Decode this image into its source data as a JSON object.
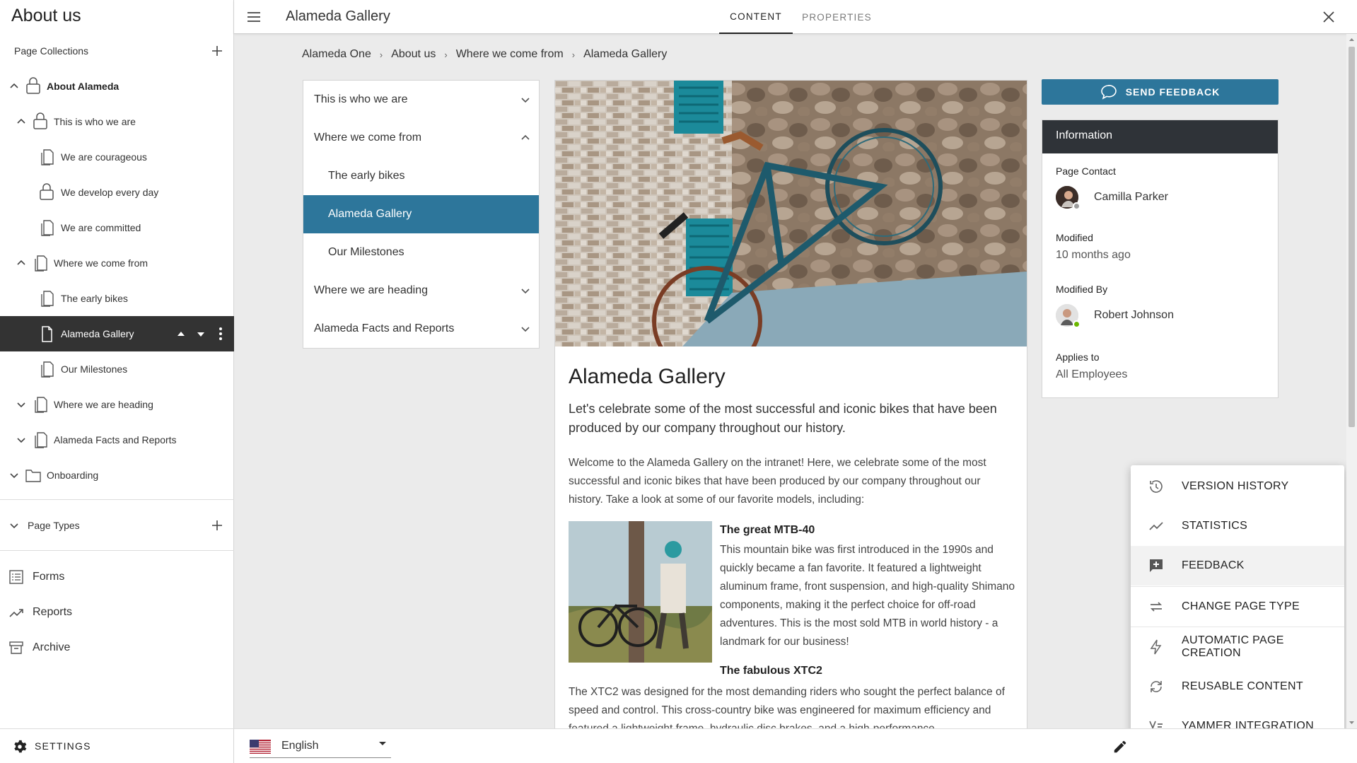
{
  "sidebar": {
    "title": "About us",
    "page_collections_label": "Page Collections",
    "tree": [
      {
        "label": "About Alameda"
      },
      {
        "label": "This is who we are"
      },
      {
        "label": "We are courageous"
      },
      {
        "label": "We develop every day"
      },
      {
        "label": "We are committed"
      },
      {
        "label": "Where we come from"
      },
      {
        "label": "The early bikes"
      },
      {
        "label": "Alameda Gallery"
      },
      {
        "label": "Our Milestones"
      },
      {
        "label": "Where we are heading"
      },
      {
        "label": "Alameda Facts and Reports"
      },
      {
        "label": "Onboarding"
      }
    ],
    "page_types_label": "Page Types",
    "links": [
      {
        "label": "Forms"
      },
      {
        "label": "Reports"
      },
      {
        "label": "Archive"
      }
    ],
    "settings_label": "SETTINGS"
  },
  "topbar": {
    "title": "Alameda Gallery",
    "tabs": [
      {
        "label": "CONTENT"
      },
      {
        "label": "PROPERTIES"
      }
    ]
  },
  "breadcrumb": [
    "Alameda One",
    "About us",
    "Where we come from",
    "Alameda Gallery"
  ],
  "page_nav": [
    {
      "label": "This is who we are"
    },
    {
      "label": "Where we come from"
    },
    {
      "label": "The early bikes"
    },
    {
      "label": "Alameda Gallery"
    },
    {
      "label": "Our Milestones"
    },
    {
      "label": "Where we are heading"
    },
    {
      "label": "Alameda Facts and Reports"
    }
  ],
  "content": {
    "title": "Alameda Gallery",
    "lead": "Let's celebrate some of the most successful and iconic bikes that have been produced by our company throughout our history.",
    "intro": "Welcome to the Alameda Gallery on the intranet! Here, we celebrate some of the most successful and iconic bikes that have been produced by our company throughout our history. Take a look at some of our favorite models, including:",
    "section1_title": "The great MTB-40",
    "section1_text": "This mountain bike was first introduced in the 1990s and quickly became a fan favorite. It featured a lightweight aluminum frame, front suspension, and high-quality Shimano components, making it the perfect choice for off-road adventures. This is the most sold MTB in world history - a landmark for our business!",
    "section2_title": "The fabulous XTC2",
    "section2_text": "The XTC2 was designed for the most demanding riders who sought the perfect balance of speed and control. This cross-country bike was engineered for maximum efficiency and featured a lightweight frame, hydraulic disc brakes, and a high-performance"
  },
  "feedback_button": {
    "label": "SEND FEEDBACK"
  },
  "info": {
    "heading": "Information",
    "page_contact_label": "Page Contact",
    "page_contact": "Camilla Parker",
    "modified_label": "Modified",
    "modified": "10 months ago",
    "modified_by_label": "Modified By",
    "modified_by": "Robert Johnson",
    "applies_to_label": "Applies to",
    "applies_to": "All Employees"
  },
  "menu": [
    {
      "label": "VERSION HISTORY",
      "icon": "history-icon"
    },
    {
      "label": "STATISTICS",
      "icon": "trending-icon"
    },
    {
      "label": "FEEDBACK",
      "icon": "feedback-icon"
    },
    {
      "label": "CHANGE PAGE TYPE",
      "icon": "swap-icon"
    },
    {
      "label": "AUTOMATIC PAGE CREATION",
      "icon": "lightning-icon"
    },
    {
      "label": "REUSABLE CONTENT",
      "icon": "sync-icon"
    },
    {
      "label": "YAMMER INTEGRATION",
      "icon": "yammer-icon"
    }
  ],
  "bottombar": {
    "language": "English"
  },
  "colors": {
    "accent": "#2d769b",
    "dark": "#333333",
    "info_header": "#2f3338"
  }
}
